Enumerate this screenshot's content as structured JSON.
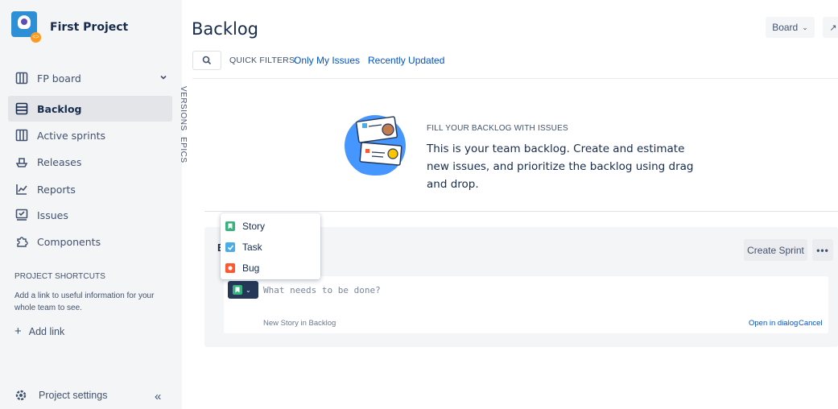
{
  "project": {
    "name": "First Project"
  },
  "sidebar": {
    "board_selector": "FP board",
    "items": [
      {
        "label": "Backlog",
        "icon": "backlog-icon",
        "active": true
      },
      {
        "label": "Active sprints",
        "icon": "columns-icon"
      },
      {
        "label": "Releases",
        "icon": "ship-icon"
      },
      {
        "label": "Reports",
        "icon": "chart-icon"
      },
      {
        "label": "Issues",
        "icon": "issues-icon"
      },
      {
        "label": "Components",
        "icon": "puzzle-icon"
      }
    ],
    "shortcuts_heading": "PROJECT SHORTCUTS",
    "shortcuts_text": "Add a link to useful information for your whole team to see.",
    "add_link": "Add link",
    "add_link_glyph": "+",
    "settings": "Project settings",
    "collapse_glyph": "«"
  },
  "vertical_tabs": [
    "VERSIONS",
    "EPICS"
  ],
  "header": {
    "title": "Backlog",
    "board_button": "Board",
    "board_caret": "⌄",
    "expand_glyph": "↗"
  },
  "filters": {
    "label": "QUICK FILTERS:",
    "links": [
      "Only My Issues",
      "Recently Updated"
    ]
  },
  "empty_state": {
    "heading": "FILL YOUR BACKLOG WITH ISSUES",
    "text": "This is your team backlog. Create and estimate new issues, and prioritize the backlog using drag and drop."
  },
  "backlog": {
    "label": "B",
    "create_sprint": "Create Sprint",
    "more": "•••",
    "type_caret": "⌄",
    "summary_placeholder": "What needs to be done?",
    "new_story_text": "New Story in Backlog",
    "open_in_dialog": "Open in dialog",
    "cancel": "Cancel"
  },
  "issue_type_menu": [
    {
      "label": "Story",
      "color": "#36b37e",
      "icon": "story-icon"
    },
    {
      "label": "Task",
      "color": "#4bade8",
      "icon": "task-icon"
    },
    {
      "label": "Bug",
      "color": "#ff5630",
      "icon": "bug-icon"
    }
  ]
}
